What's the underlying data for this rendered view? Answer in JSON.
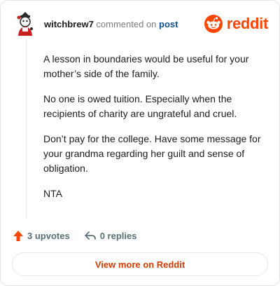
{
  "header": {
    "username": "witchbrew7",
    "commented_text": "commented on",
    "post_link": "post",
    "brand_name": "reddit"
  },
  "comment": {
    "paragraphs": [
      "A lesson in boundaries would be useful for your mother’s side of the family.",
      "No one is owed tuition. Especially when the recipients of charity are ungrateful and cruel.",
      "Don’t pay for the college. Have some message for your grandma regarding her guilt and sense of obligation.",
      "NTA"
    ]
  },
  "actions": {
    "upvotes": "3 upvotes",
    "replies": "0 replies"
  },
  "footer": {
    "view_more": "View more on Reddit"
  },
  "colors": {
    "brand": "#ff4500",
    "upvote_arrow": "#ff4500",
    "link_text": "#d93a00"
  }
}
